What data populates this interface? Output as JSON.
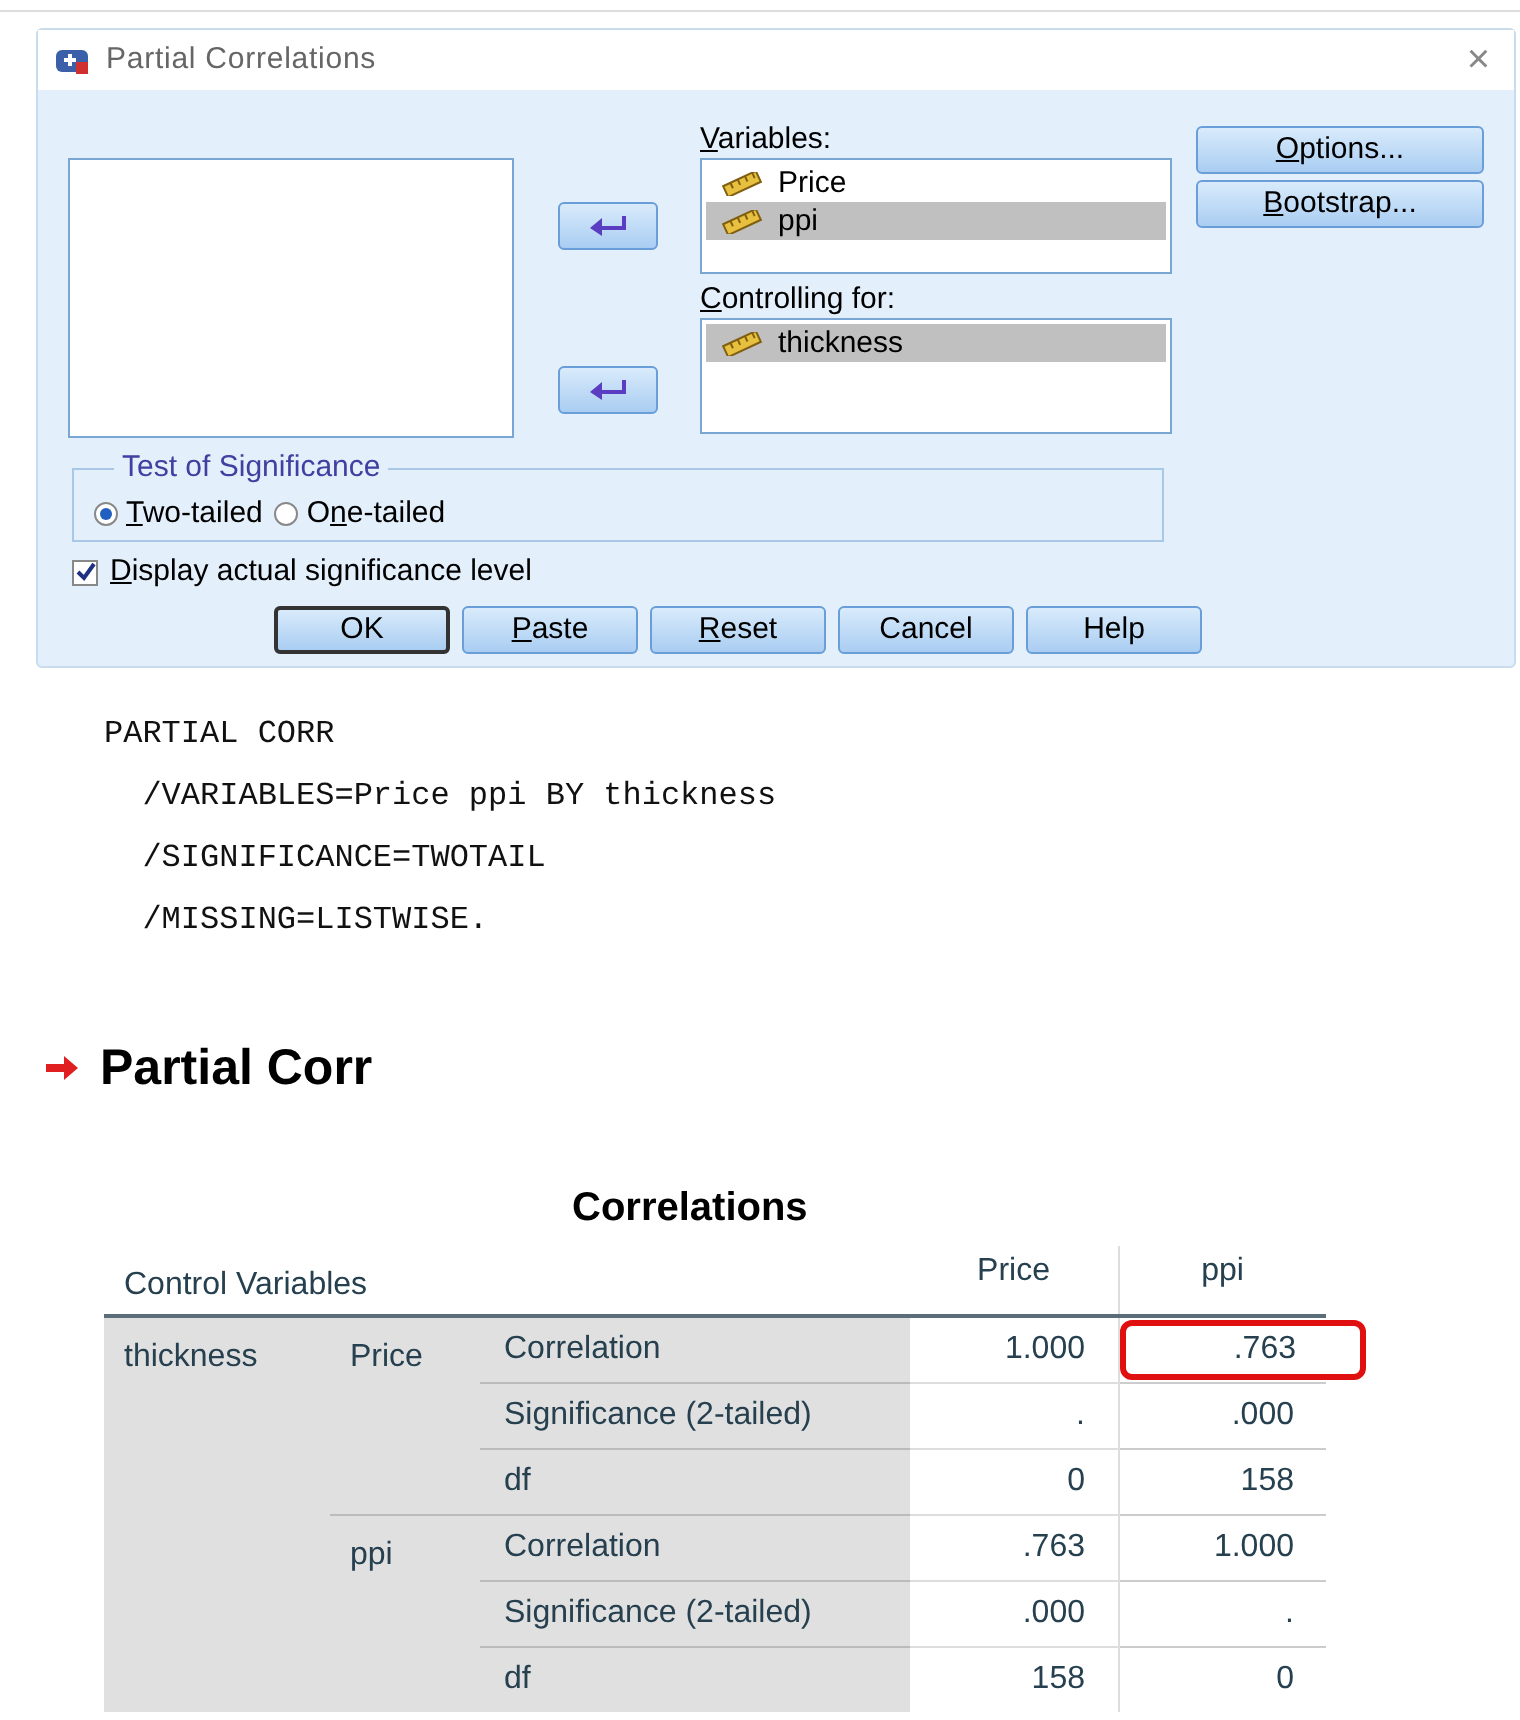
{
  "dialog": {
    "title": "Partial Correlations",
    "close": "×",
    "variables": {
      "label": {
        "key": "V",
        "post": "ariables:"
      },
      "items": [
        {
          "name": "Price",
          "selected": false
        },
        {
          "name": "ppi",
          "selected": true
        }
      ]
    },
    "controlling": {
      "label": {
        "key": "C",
        "post": "ontrolling for:"
      },
      "items": [
        {
          "name": "thickness",
          "selected": true
        }
      ]
    },
    "side_buttons": [
      {
        "key": "O",
        "post": "ptions..."
      },
      {
        "key": "B",
        "post": "ootstrap..."
      }
    ],
    "test": {
      "legend": "Test of Significance",
      "options": [
        {
          "key": "T",
          "post": "wo-tailed",
          "selected": true
        },
        {
          "pre": "O",
          "key": "n",
          "post": "e-tailed",
          "selected": false
        }
      ]
    },
    "display_actual": {
      "key": "D",
      "post": "isplay actual significance level",
      "checked": true
    },
    "buttons": [
      {
        "pre": "OK",
        "default": true
      },
      {
        "key": "P",
        "post": "aste",
        "default": false
      },
      {
        "key": "R",
        "post": "eset",
        "default": false
      },
      {
        "pre": "Cancel",
        "default": false
      },
      {
        "pre": "Help",
        "default": false
      }
    ]
  },
  "syntax": [
    "PARTIAL CORR",
    "  /VARIABLES=Price ppi BY thickness",
    "  /SIGNIFICANCE=TWOTAIL",
    "  /MISSING=LISTWISE."
  ],
  "heading": "Partial Corr",
  "table": {
    "title": "Correlations",
    "header": "Control Variables",
    "columns": [
      "Price",
      "ppi"
    ],
    "control": "thickness",
    "groups": [
      {
        "variable": "Price",
        "rows": [
          {
            "stat": "Correlation",
            "values": [
              "1.000",
              ".763"
            ],
            "highlighted": [
              false,
              true
            ]
          },
          {
            "stat": "Significance (2-tailed)",
            "values": [
              ".",
              ".000"
            ],
            "highlighted": [
              false,
              false
            ]
          },
          {
            "stat": "df",
            "values": [
              "0",
              "158"
            ],
            "highlighted": [
              false,
              false
            ]
          }
        ]
      },
      {
        "variable": "ppi",
        "rows": [
          {
            "stat": "Correlation",
            "values": [
              ".763",
              "1.000"
            ],
            "highlighted": [
              false,
              false
            ]
          },
          {
            "stat": "Significance (2-tailed)",
            "values": [
              ".000",
              "."
            ],
            "highlighted": [
              false,
              false
            ]
          },
          {
            "stat": "df",
            "values": [
              "158",
              "0"
            ],
            "highlighted": [
              false,
              false
            ]
          }
        ]
      }
    ]
  }
}
